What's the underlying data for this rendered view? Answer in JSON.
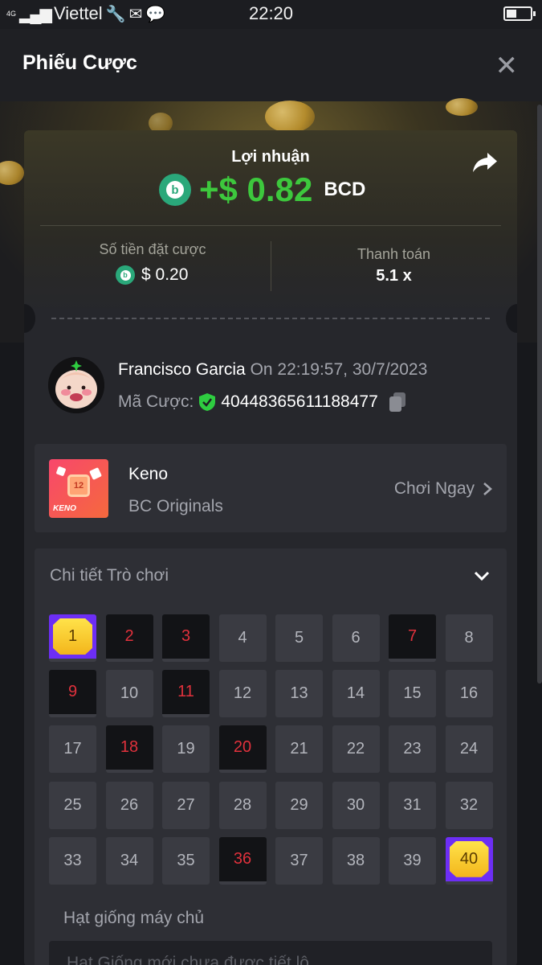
{
  "status_bar": {
    "network": "4G",
    "carrier": "Viettel",
    "time": "22:20"
  },
  "header": {
    "title": "Phiếu Cược"
  },
  "bet": {
    "profit_label": "Lợi nhuận",
    "profit_amount": "+$ 0.82",
    "currency": "BCD",
    "stake_label": "Số tiền đặt cược",
    "stake_value": "$ 0.20",
    "payout_label": "Thanh toán",
    "payout_value": "5.1 x"
  },
  "user": {
    "name": "Francisco Garcia",
    "time": "On 22:19:57, 30/7/2023",
    "bet_id_label": "Mã Cược:",
    "bet_id": "40448365611188477"
  },
  "game": {
    "name": "Keno",
    "provider": "BC Originals",
    "play_label": "Chơi Ngay",
    "thumb_number": "12",
    "thumb_text": "KENO"
  },
  "details": {
    "title": "Chi tiết Trò chơi",
    "numbers": [
      "1",
      "2",
      "3",
      "4",
      "5",
      "6",
      "7",
      "8",
      "9",
      "10",
      "11",
      "12",
      "13",
      "14",
      "15",
      "16",
      "17",
      "18",
      "19",
      "20",
      "21",
      "22",
      "23",
      "24",
      "25",
      "26",
      "27",
      "28",
      "29",
      "30",
      "31",
      "32",
      "33",
      "34",
      "35",
      "36",
      "37",
      "38",
      "39",
      "40"
    ],
    "picked": [
      "2",
      "3",
      "7",
      "9",
      "11",
      "18",
      "20",
      "36"
    ],
    "hits": [
      "1",
      "40"
    ],
    "seed_label": "Hạt giống máy chủ",
    "seed_placeholder": "Hạt Giống mới chưa được tiết lộ"
  },
  "colors": {
    "profit": "#3dc83d",
    "accent_purple": "#6d2ef5",
    "gem": "#f3b51b",
    "miss": "#e0313c",
    "coin": "#2aa87a"
  }
}
